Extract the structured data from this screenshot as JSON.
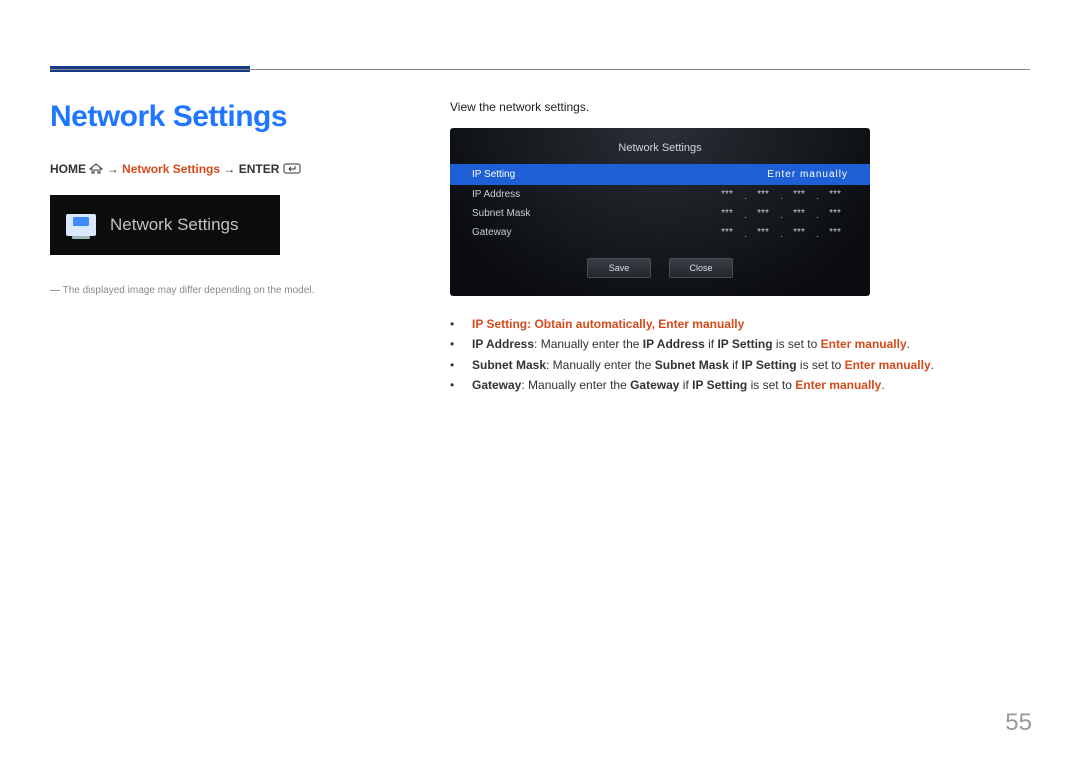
{
  "header": {
    "title": "Network Settings"
  },
  "breadcrumb": {
    "home": "HOME",
    "arrow1": "→",
    "step": "Network Settings",
    "arrow2": "→",
    "enter": "ENTER"
  },
  "thumb": {
    "label": "Network Settings"
  },
  "footnote": "The displayed image may differ depending on the model.",
  "intro": "View the network settings.",
  "panel": {
    "title": "Network Settings",
    "ip_setting": {
      "label": "IP Setting",
      "value": "Enter manually"
    },
    "rows": [
      {
        "label": "IP Address",
        "v1": "***",
        "v2": "***",
        "v3": "***",
        "v4": "***"
      },
      {
        "label": "Subnet Mask",
        "v1": "***",
        "v2": "***",
        "v3": "***",
        "v4": "***"
      },
      {
        "label": "Gateway",
        "v1": "***",
        "v2": "***",
        "v3": "***",
        "v4": "***"
      }
    ],
    "buttons": {
      "save": "Save",
      "close": "Close"
    }
  },
  "descriptions": {
    "ip_setting": {
      "label": "IP Setting",
      "sep": ": ",
      "opt1": "Obtain automatically",
      "comma": ", ",
      "opt2": "Enter manually"
    },
    "ip_address": {
      "label": "IP Address",
      "t1": ": Manually enter the ",
      "ref": "IP Address",
      "t2": " if ",
      "ref2": "IP Setting",
      "t3": " is set to ",
      "val": "Enter manually",
      "t4": "."
    },
    "subnet": {
      "label": "Subnet Mask",
      "t1": ": Manually enter the ",
      "ref": "Subnet Mask",
      "t2": " if ",
      "ref2": "IP Setting",
      "t3": " is set to ",
      "val": "Enter manually",
      "t4": "."
    },
    "gateway": {
      "label": "Gateway",
      "t1": ": Manually enter the ",
      "ref": "Gateway",
      "t2": " if ",
      "ref2": "IP Setting",
      "t3": " is set to ",
      "val": "Enter manually",
      "t4": "."
    }
  },
  "page_number": "55"
}
